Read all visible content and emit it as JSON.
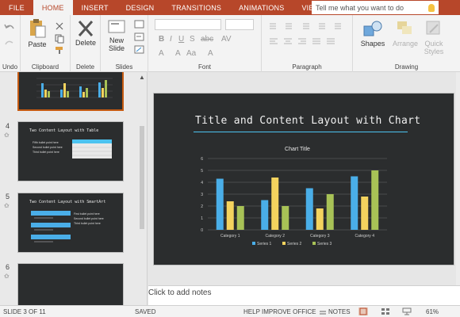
{
  "tabs": [
    "FILE",
    "HOME",
    "INSERT",
    "DESIGN",
    "TRANSITIONS",
    "ANIMATIONS",
    "VIEW"
  ],
  "active_tab": "HOME",
  "tellme": {
    "placeholder": "Tell me what you want to do"
  },
  "ribbon": {
    "undo_label": "Undo",
    "clipboard": {
      "paste": "Paste",
      "group": "Clipboard"
    },
    "delete": {
      "button": "Delete",
      "group": "Delete"
    },
    "slides": {
      "new_slide_line1": "New",
      "new_slide_line2": "Slide",
      "group": "Slides"
    },
    "font": {
      "group": "Font"
    },
    "paragraph": {
      "group": "Paragraph"
    },
    "drawing": {
      "shapes": "Shapes",
      "arrange": "Arrange",
      "quick_styles_line1": "Quick",
      "quick_styles_line2": "Styles",
      "group": "Drawing"
    }
  },
  "thumbnails": [
    {
      "number": "4",
      "title": "Two Content Layout with Table",
      "bullets": [
        "Fifth bullet point here",
        "Second bullet point here",
        "Third bullet point here"
      ]
    },
    {
      "number": "5",
      "title": "Two Content Layout with SmartArt",
      "bullets": [
        "First bullet point here",
        "Second bullet point here",
        "Third bullet point here"
      ]
    },
    {
      "number": "6",
      "title": "",
      "bullets": []
    }
  ],
  "slide": {
    "title": "Title and Content Layout with Chart"
  },
  "chart_data": {
    "type": "bar",
    "title": "Chart Title",
    "categories": [
      "Category 1",
      "Category 2",
      "Category 3",
      "Category 4"
    ],
    "series": [
      {
        "name": "Series 1",
        "color": "#4aaee8",
        "values": [
          4.3,
          2.5,
          3.5,
          4.5
        ]
      },
      {
        "name": "Series 2",
        "color": "#f4d35e",
        "values": [
          2.4,
          4.4,
          1.8,
          2.8
        ]
      },
      {
        "name": "Series 3",
        "color": "#a8c256",
        "values": [
          2.0,
          2.0,
          3.0,
          5.0
        ]
      }
    ],
    "yticks": [
      "0",
      "1",
      "2",
      "3",
      "4",
      "5",
      "6"
    ],
    "ylim": [
      0,
      6
    ],
    "legend": "bottom"
  },
  "notes": {
    "placeholder": "Click to add notes"
  },
  "status": {
    "slide_info": "SLIDE 3 OF 11",
    "saved": "SAVED",
    "help": "HELP IMPROVE OFFICE",
    "notes": "NOTES",
    "zoom": "61%"
  },
  "colors": {
    "accent": "#b7472a",
    "slide_bg": "#2b2d2e",
    "title_line": "#4cc3f0"
  }
}
